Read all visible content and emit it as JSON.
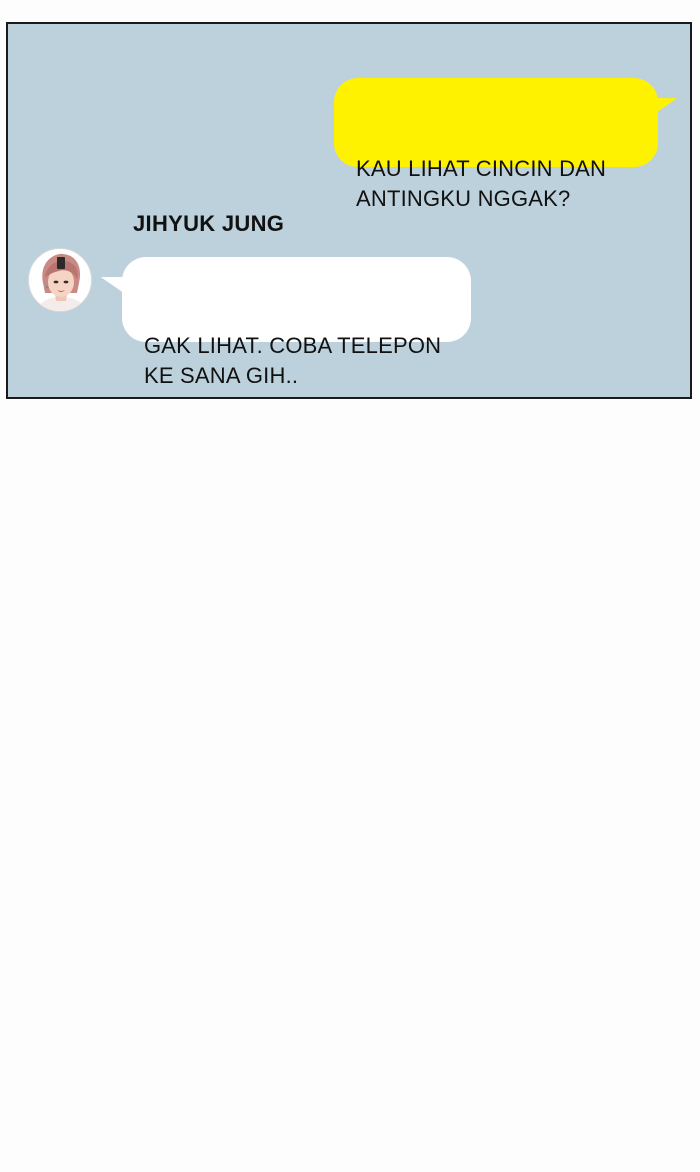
{
  "chat": {
    "outgoing_message": "KAU LIHAT CINCIN DAN\nANTINGKU NGGAK?",
    "incoming_sender": "JIHYUK JUNG",
    "incoming_message": "GAK LIHAT. COBA TELEPON\nKE SANA GIH..",
    "avatar_icon": "person-avatar-icon"
  },
  "colors": {
    "panel_background": "#bdd1dc",
    "outgoing_bubble": "#fff200",
    "incoming_bubble": "#ffffff",
    "page_background": "#fdfdfd"
  }
}
